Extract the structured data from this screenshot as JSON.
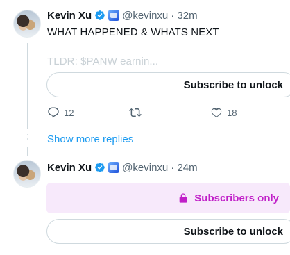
{
  "tweet1": {
    "name": "Kevin Xu",
    "handle": "@kevinxu",
    "time": "· 32m",
    "text": "WHAT HAPPENED & WHATS NEXT",
    "preview": "TLDR: $PANW earnin...",
    "unlock_label": "Subscribe to unlock",
    "replies": "12",
    "likes": "18"
  },
  "show_more": "Show more replies",
  "tweet2": {
    "name": "Kevin Xu",
    "handle": "@kevinxu",
    "time": "· 24m",
    "subscribers_only": "Subscribers only",
    "unlock_label": "Subscribe to unlock"
  },
  "colors": {
    "verified": "#1d9bf0",
    "link": "#1d9bf0",
    "subscribers_text": "#c01fc8",
    "subscribers_bg": "#f7e9fb"
  }
}
